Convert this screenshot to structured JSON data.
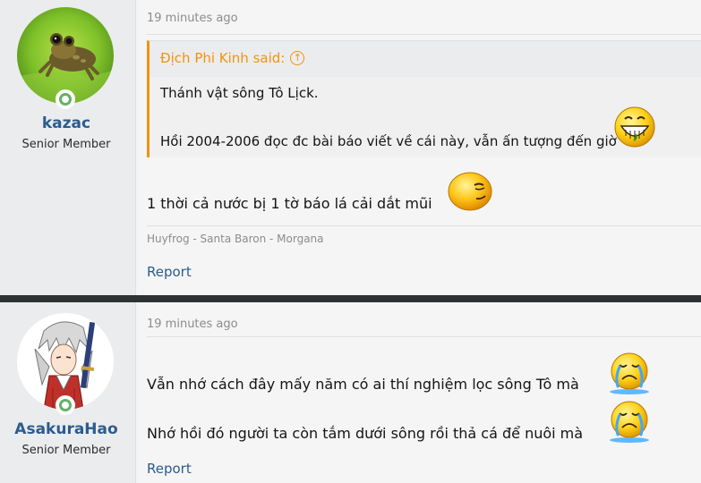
{
  "posts": [
    {
      "username": "kazac",
      "user_title": "Senior Member",
      "time": "19 minutes ago",
      "quote": {
        "author_said": "Địch Phi Kinh said:",
        "lines": [
          "Thánh vật sông Tô Lịck.",
          "Hồi 2004-2006 đọc đc bài báo viết về cái này, vẫn ấn tượng đến giờ"
        ]
      },
      "message": "1 thời cả nước bị 1 tờ báo lá cải dắt mũi",
      "signature": "Huyfrog - Santa Baron - Morgana",
      "report_label": "Report"
    },
    {
      "username": "AsakuraHao",
      "user_title": "Senior Member",
      "time": "19 minutes ago",
      "messages": [
        "Vẫn nhớ cách đây mấy năm có ai thí nghiệm lọc sông Tô mà",
        "Nhớ hồi đó người ta còn tắm dưới sông rồi thả cá để nuôi mà"
      ],
      "report_label": "Report"
    }
  ],
  "colors": {
    "link": "#2b5c8f",
    "quote_accent": "#f2930d",
    "online": "#63b265",
    "divider": "#2f3233"
  },
  "icons": [
    "frog-avatar",
    "anime-avatar",
    "online-status-icon",
    "quote-jump-icon",
    "grin-smiley-icon",
    "smirk-smiley-icon",
    "crying-smiley-icon"
  ]
}
